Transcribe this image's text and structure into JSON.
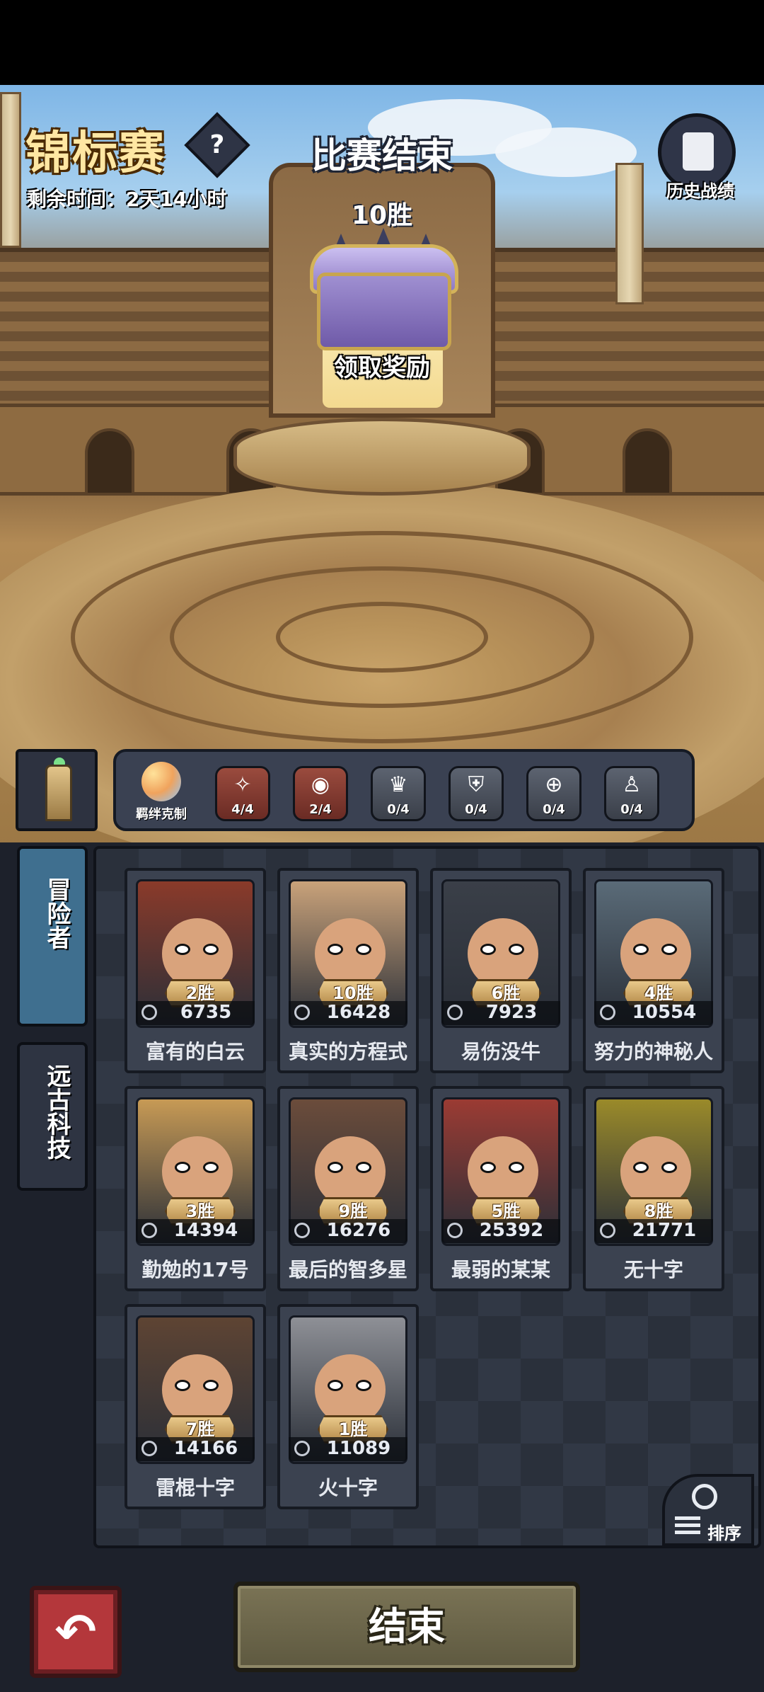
{
  "header": {
    "event_title": "锦标赛",
    "help_icon": "question-icon",
    "help_symbol": "?",
    "time_left": "剩余时间：2天14小时",
    "status": "比赛结束",
    "wins": "10胜",
    "history_label": "历史战绩",
    "history_icon": "scroll-icon"
  },
  "reward": {
    "label": "领取奖励",
    "icon": "treasure-chest-icon"
  },
  "synergy": {
    "main_label": "羁绊克制",
    "items": [
      {
        "icon": "sparkle-icon",
        "glyph": "✧",
        "count": "4/4",
        "active": true
      },
      {
        "icon": "eye-icon",
        "glyph": "◉",
        "count": "2/4",
        "active": true
      },
      {
        "icon": "crown-icon",
        "glyph": "♛",
        "count": "0/4",
        "active": false
      },
      {
        "icon": "shield-icon",
        "glyph": "⛨",
        "count": "0/4",
        "active": false
      },
      {
        "icon": "target-icon",
        "glyph": "⊕",
        "count": "0/4",
        "active": false
      },
      {
        "icon": "person-icon",
        "glyph": "♙",
        "count": "0/4",
        "active": false
      }
    ]
  },
  "tabs": [
    {
      "label": "冒险者",
      "active": true
    },
    {
      "label": "远古科技",
      "active": false
    }
  ],
  "heroes": [
    {
      "name": "富有的白云",
      "wins": "2胜",
      "power": "6735",
      "color": "#8a3a2a"
    },
    {
      "name": "真实的方程式",
      "wins": "10胜",
      "power": "16428",
      "color": "#c9a27a"
    },
    {
      "name": "易伤没牛",
      "wins": "6胜",
      "power": "7923",
      "color": "#3a3f48"
    },
    {
      "name": "努力的神秘人",
      "wins": "4胜",
      "power": "10554",
      "color": "#5a6b78"
    },
    {
      "name": "勤勉的17号",
      "wins": "3胜",
      "power": "14394",
      "color": "#c79a55"
    },
    {
      "name": "最后的智多星",
      "wins": "9胜",
      "power": "16276",
      "color": "#6b4c3b"
    },
    {
      "name": "最弱的某某",
      "wins": "5胜",
      "power": "25392",
      "color": "#9b3b33"
    },
    {
      "name": "无十字",
      "wins": "8胜",
      "power": "21771",
      "color": "#9a8a2a"
    },
    {
      "name": "雷棍十字",
      "wins": "7胜",
      "power": "14166",
      "color": "#5e4433"
    },
    {
      "name": "火十字",
      "wins": "1胜",
      "power": "11089",
      "color": "#8e9096"
    }
  ],
  "sort": {
    "label": "排序",
    "icon": "search-sort-icon"
  },
  "buttons": {
    "back_icon": "back-arrow-icon",
    "back_glyph": "↶",
    "end_label": "结束"
  }
}
